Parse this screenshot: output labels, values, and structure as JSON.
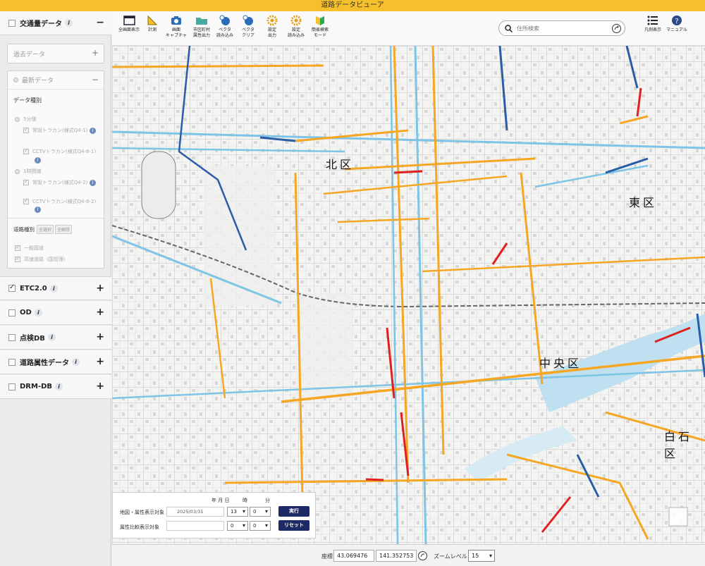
{
  "app_title": "道路データビューア",
  "sidebar": {
    "traffic": {
      "label": "交通量データ",
      "toggle": "−"
    },
    "past": {
      "label": "過去データ",
      "toggle": "+"
    },
    "latest": {
      "label": "最新データ",
      "toggle": "−"
    },
    "data_type_label": "データ種別",
    "five_min": "5分値",
    "five_min_opt1": "常設トラカン(様式Q4-1)",
    "five_min_opt2": "CCTVトラカン(様式Q4-8-1)",
    "hourly": "1時間値",
    "hourly_opt1": "常設トラカン(様式Q4-2)",
    "hourly_opt2": "CCTVトラカン(様式Q4-8-2)",
    "road_type_label": "道路種別",
    "select_all": "全選択",
    "clear_all": "全解除",
    "road_general": "一般国道",
    "road_expressway": "高速道路（国管理）",
    "etc": {
      "label": "ETC2.0",
      "toggle": "+"
    },
    "od": {
      "label": "OD",
      "toggle": "+"
    },
    "inspection": {
      "label": "点検DB",
      "toggle": "+"
    },
    "road_attr": {
      "label": "道路属性データ",
      "toggle": "+"
    },
    "drm": {
      "label": "DRM-DB",
      "toggle": "+"
    }
  },
  "toolbar": {
    "fullscreen": [
      "全画面表示"
    ],
    "measure": [
      "計測"
    ],
    "capture": [
      "画面",
      "キャプチャ"
    ],
    "municipal": [
      "市区町村",
      "属性出力"
    ],
    "vector_load": [
      "ベクタ",
      "読み込み"
    ],
    "vector_clear": [
      "ベクタ",
      "クリア"
    ],
    "settings_out": [
      "設定",
      "出力"
    ],
    "settings_load": [
      "設定",
      "読み込み"
    ],
    "beginner": [
      "簡易検索",
      "モード"
    ],
    "legend": [
      "凡例表示"
    ],
    "manual": [
      "マニュアル"
    ]
  },
  "search": {
    "placeholder": "住所検索"
  },
  "map_labels": {
    "kita_ku": "北区",
    "higashi_ku": "東区",
    "chuo_ku": "中央区",
    "shiroishi_ku": "白石区"
  },
  "date_panel": {
    "year_month_day": "年 月 日",
    "hour": "時",
    "minute": "分",
    "map_target_label": "地図・属性表示対象",
    "compare_target_label": "属性比較表示対象",
    "date_value": "2025/03/31",
    "hour_value": "13",
    "minute_value": "0",
    "compare_hour": "0",
    "compare_minute": "0",
    "execute": "実行",
    "reset": "リセット"
  },
  "bottom_bar": {
    "coord_label": "座標",
    "lat": "43.069476",
    "lon": "141.352753",
    "zoom_label": "ズームレベル",
    "zoom_value": "15"
  },
  "colors": {
    "title_bar": "#f5c02c",
    "button_navy": "#1e2a66",
    "road_orange": "#f5a623",
    "road_blue": "#2a5ca8",
    "road_red": "#e02020"
  }
}
